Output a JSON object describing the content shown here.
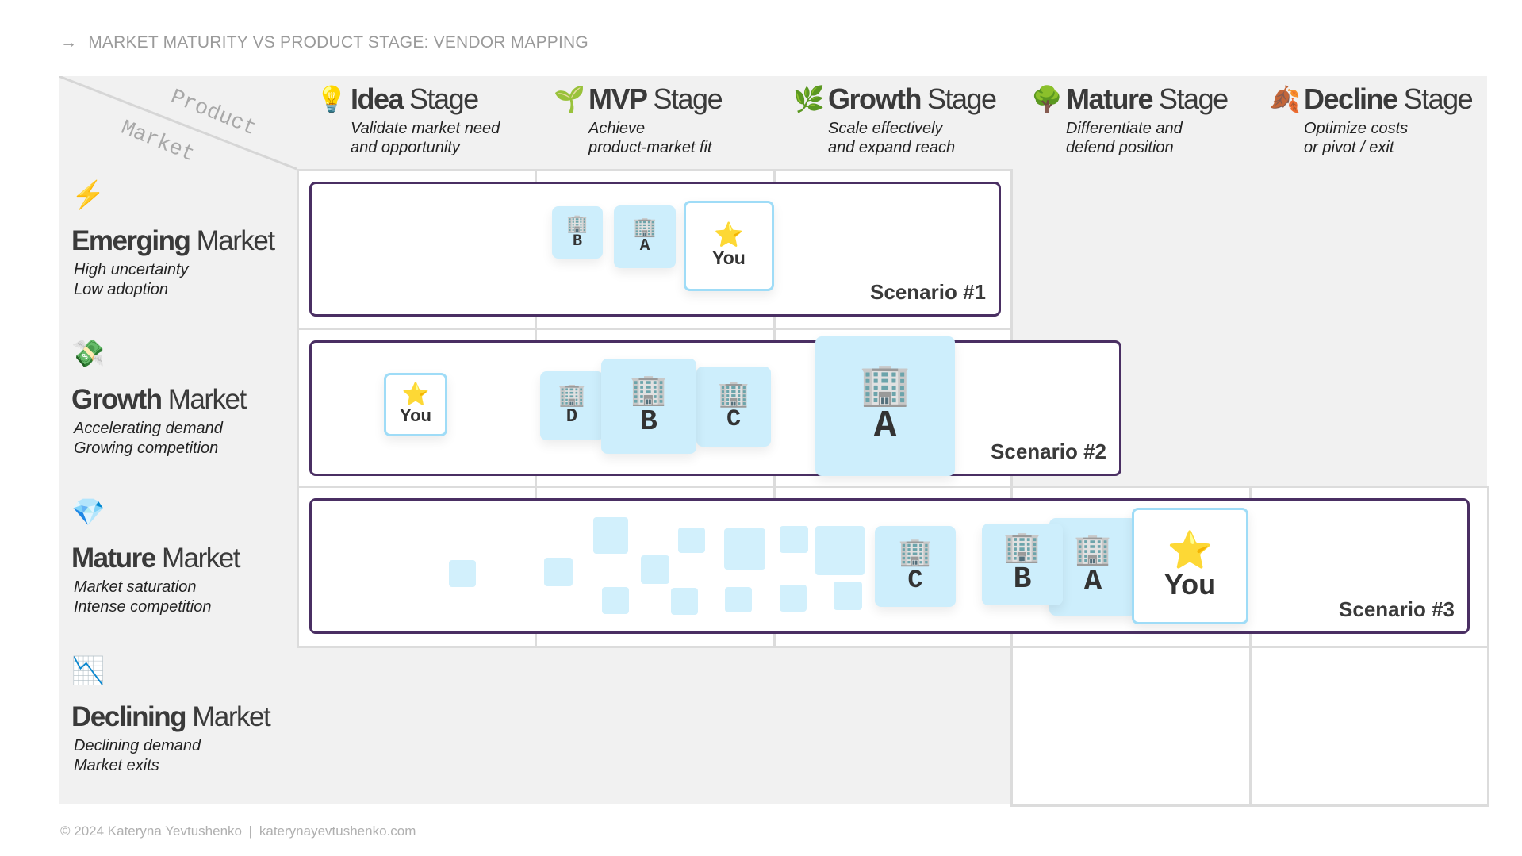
{
  "title": {
    "arrow": "→",
    "text": "MARKET MATURITY VS PRODUCT STAGE: VENDOR MAPPING"
  },
  "axes": {
    "product_label": "Product",
    "market_label": "Market"
  },
  "stages": [
    {
      "icon": "💡",
      "bold": "Idea",
      "rest": "Stage",
      "sub1": "Validate market need",
      "sub2": "and opportunity"
    },
    {
      "icon": "🌱",
      "bold": "MVP",
      "rest": "Stage",
      "sub1": "Achieve",
      "sub2": "product-market fit"
    },
    {
      "icon": "🌿",
      "bold": "Growth",
      "rest": "Stage",
      "sub1": "Scale effectively",
      "sub2": "and expand reach"
    },
    {
      "icon": "🌳",
      "bold": "Mature",
      "rest": "Stage",
      "sub1": "Differentiate and",
      "sub2": "defend position"
    },
    {
      "icon": "🍂",
      "bold": "Decline",
      "rest": "Stage",
      "sub1": "Optimize costs",
      "sub2": "or pivot / exit"
    }
  ],
  "markets": [
    {
      "icon": "⚡",
      "bold": "Emerging",
      "rest": "Market",
      "sub1": "High uncertainty",
      "sub2": "Low adoption"
    },
    {
      "icon": "💸",
      "bold": "Growth",
      "rest": "Market",
      "sub1": "Accelerating demand",
      "sub2": "Growing competition"
    },
    {
      "icon": "💎",
      "bold": "Mature",
      "rest": "Market",
      "sub1": "Market saturation",
      "sub2": "Intense competition"
    },
    {
      "icon": "📉",
      "bold": "Declining",
      "rest": "Market",
      "sub1": "Declining demand",
      "sub2": "Market exits"
    }
  ],
  "scenarios": [
    {
      "label": "Scenario #1",
      "vendors": [
        {
          "name": "B"
        },
        {
          "name": "A"
        }
      ],
      "you": "You"
    },
    {
      "label": "Scenario #2",
      "vendors": [
        {
          "name": "D"
        },
        {
          "name": "B"
        },
        {
          "name": "C"
        },
        {
          "name": "A"
        }
      ],
      "you": "You"
    },
    {
      "label": "Scenario #3",
      "vendors": [
        {
          "name": "C"
        },
        {
          "name": "B"
        },
        {
          "name": "A"
        }
      ],
      "you": "You"
    }
  ],
  "icons": {
    "vendor": "🏢",
    "you": "⭐"
  },
  "colors": {
    "scenario_border": "#4a2f63",
    "vendor_card": "#cdeefc",
    "you_border": "#9fdcf7",
    "panel": "#f1f1f1",
    "grid": "#dcdcdc"
  },
  "footer": {
    "copyright": "© 2024 Kateryna Yevtushenko",
    "separator": "|",
    "site": "katerynayevtushenko.com"
  }
}
